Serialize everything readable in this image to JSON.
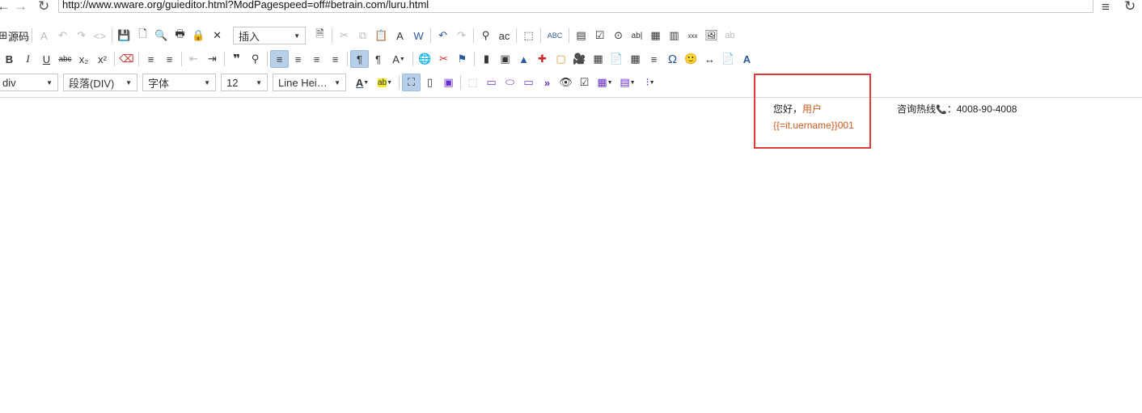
{
  "browser": {
    "url": "http://www.wware.org/guieditor.html?ModPagespeed=off#betrain.com/luru.html",
    "back_glyph": "←",
    "forward_glyph": "→",
    "reload_glyph": "↻",
    "menu_glyph": "≡"
  },
  "toolbar": {
    "source_label": "源码",
    "insert_label": "插入",
    "block_format": "div",
    "paragraph_format": "段落(DIV)",
    "font_family": "字体",
    "font_size": "12",
    "line_height": "Line Hei…",
    "row1_glyphs": [
      "A",
      "↶",
      "↷",
      "<>",
      "💾",
      "🗋",
      "🔍",
      "🖶",
      "🔒",
      "✕"
    ],
    "row1b_glyphs": [
      "🗎",
      "✂",
      "⧉",
      "📋",
      "A",
      "W",
      "↶",
      "↷",
      "⚲",
      "ac",
      "⬚",
      "ABC",
      "▤",
      "☑",
      "⊙",
      "ab|",
      "▦",
      "▥",
      "xxx",
      "🖼",
      "ab"
    ],
    "row2_glyphs": [
      "I",
      "U",
      "abc",
      "x₂",
      "x²",
      "⌫",
      "≡",
      "≡",
      "⇤",
      "⇥",
      "❞",
      "⚲",
      "≡",
      "≡",
      "≡",
      "≡",
      "¶",
      "¶",
      "A",
      "🌐",
      "✂",
      "⚑",
      "▮",
      "▣",
      "▲",
      "✚",
      "▢",
      "🎥",
      "▦",
      "📄",
      "▦",
      "≡",
      "Ω",
      "🙂",
      "↔",
      "📄",
      "A"
    ],
    "row3_glyphs": [
      "A",
      "ab",
      "⛶",
      "▯",
      "▣",
      "⬚",
      "▭",
      "⬭",
      "▭",
      "»",
      "👁",
      "☑",
      "▦",
      "▤",
      "⁝"
    ]
  },
  "content": {
    "greeting_prefix": "您好，",
    "greeting_user": "用户",
    "username_tpl": "{{=it.uername}}001",
    "hotline_label": "咨询热线",
    "phone_icon": "📞",
    "hotline_number": "：4008-90-4008"
  },
  "colors": {
    "highlight": "#d05a1e",
    "annotation_box": "#e03a3a",
    "active_button": "#b8cfea"
  }
}
